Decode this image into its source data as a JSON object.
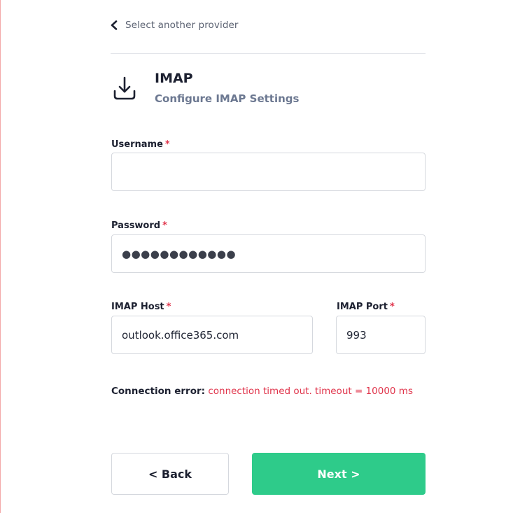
{
  "nav": {
    "back_label": "Select another provider"
  },
  "header": {
    "title": "IMAP",
    "subtitle": "Configure IMAP Settings",
    "icon": "download-icon"
  },
  "form": {
    "username": {
      "label": "Username",
      "required_mark": "*",
      "value": ""
    },
    "password": {
      "label": "Password",
      "required_mark": "*",
      "value": "●●●●●●●●●●●●"
    },
    "imap_host": {
      "label": "IMAP Host",
      "required_mark": "*",
      "value": "outlook.office365.com"
    },
    "imap_port": {
      "label": "IMAP Port",
      "required_mark": "*",
      "value": "993"
    }
  },
  "error": {
    "label": "Connection error:",
    "message": "connection timed out. timeout = 10000 ms"
  },
  "buttons": {
    "back": "< Back",
    "next": "Next >"
  },
  "colors": {
    "accent": "#2ecb8a",
    "error": "#e0344b",
    "subtitle": "#6c7891"
  }
}
